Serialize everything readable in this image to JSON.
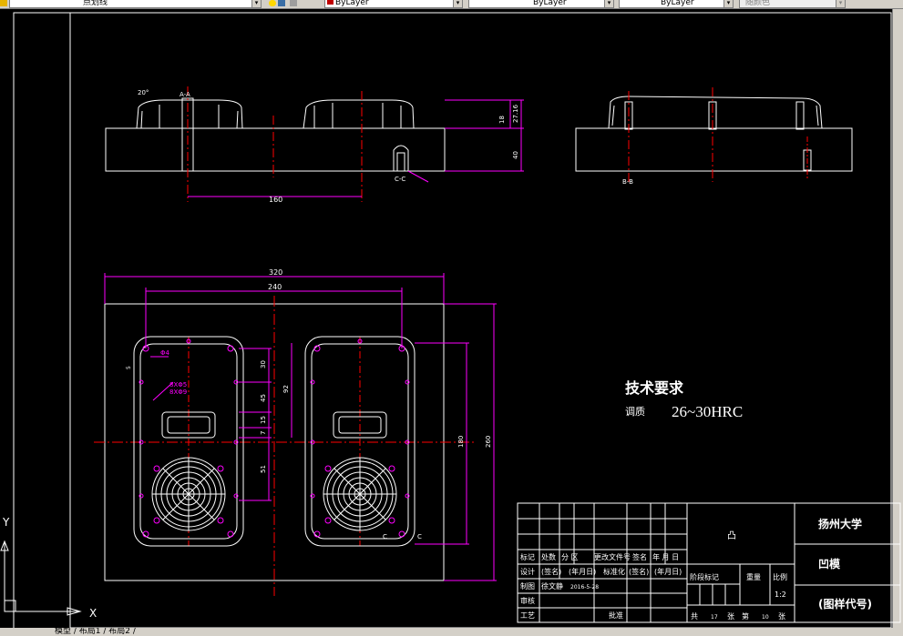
{
  "toolbar": {
    "linetype_value": "点划线",
    "layer_color_value": "ByLayer",
    "linetype2_value": "ByLayer",
    "lineweight_value": "ByLayer",
    "plotstyle_value": "随颜色"
  },
  "drawing": {
    "section_aa": "A-A",
    "section_cc": "C-C",
    "section_bb": "B-B",
    "angle_label": "20°",
    "dim_160": "160",
    "dim_18": "18",
    "dim_2716": "27.16",
    "dim_40": "40",
    "dim_320": "320",
    "dim_240": "240",
    "dim_180": "180",
    "dim_260": "260",
    "dim_92": "92",
    "dim_30": "30",
    "dim_45": "45",
    "dim_15": "15",
    "dim_7": "7",
    "dim_51": "51",
    "dim_phi4": "Φ4",
    "dim_phi8": "8XΦ5",
    "dim_phi9": "8XΦ9",
    "dim_55": "5",
    "cc_label": "C",
    "cc_label2": "C",
    "tech_title": "技术要求",
    "tech_item_label": "调质",
    "tech_item_value": "26~30HRC",
    "axis_y": "Y",
    "axis_x": "X"
  },
  "titleblock": {
    "part_name": "凸",
    "university": "扬州大学",
    "drawing_name": "凹模",
    "drawing_code": "(图样代号)",
    "scale_value": "1:2",
    "row_headers": [
      "标记",
      "处数",
      "分 区",
      "更改文件号",
      "签名",
      "年 月 日"
    ],
    "design_label": "设计",
    "design_sign": "(签名)",
    "design_date": "(年月日)",
    "standard_label": "标准化",
    "standard_sign": "(签名)",
    "standard_date": "(年月日)",
    "drawn_label": "制图",
    "drawn_name": "徐文静",
    "drawn_date": "2016-5-28",
    "review_label": "审核",
    "process_label": "工艺",
    "approve_label": "批准",
    "stage_label": "阶段标记",
    "weight_label": "重量",
    "ratio_label": "比例",
    "sheets_total_label": "共",
    "sheets_total_value": "17",
    "sheets_unit": "张",
    "sheet_no_label": "第",
    "sheet_no_value": "10",
    "sheet_unit2": "张"
  },
  "status": {
    "text": "模型 / 布局1 / 布局2 /"
  },
  "colors": {
    "background": "#000000",
    "geometry": "#ffffff",
    "dimensions": "#ff00ff",
    "centerlines": "#ff0000",
    "text": "#ffffff"
  }
}
